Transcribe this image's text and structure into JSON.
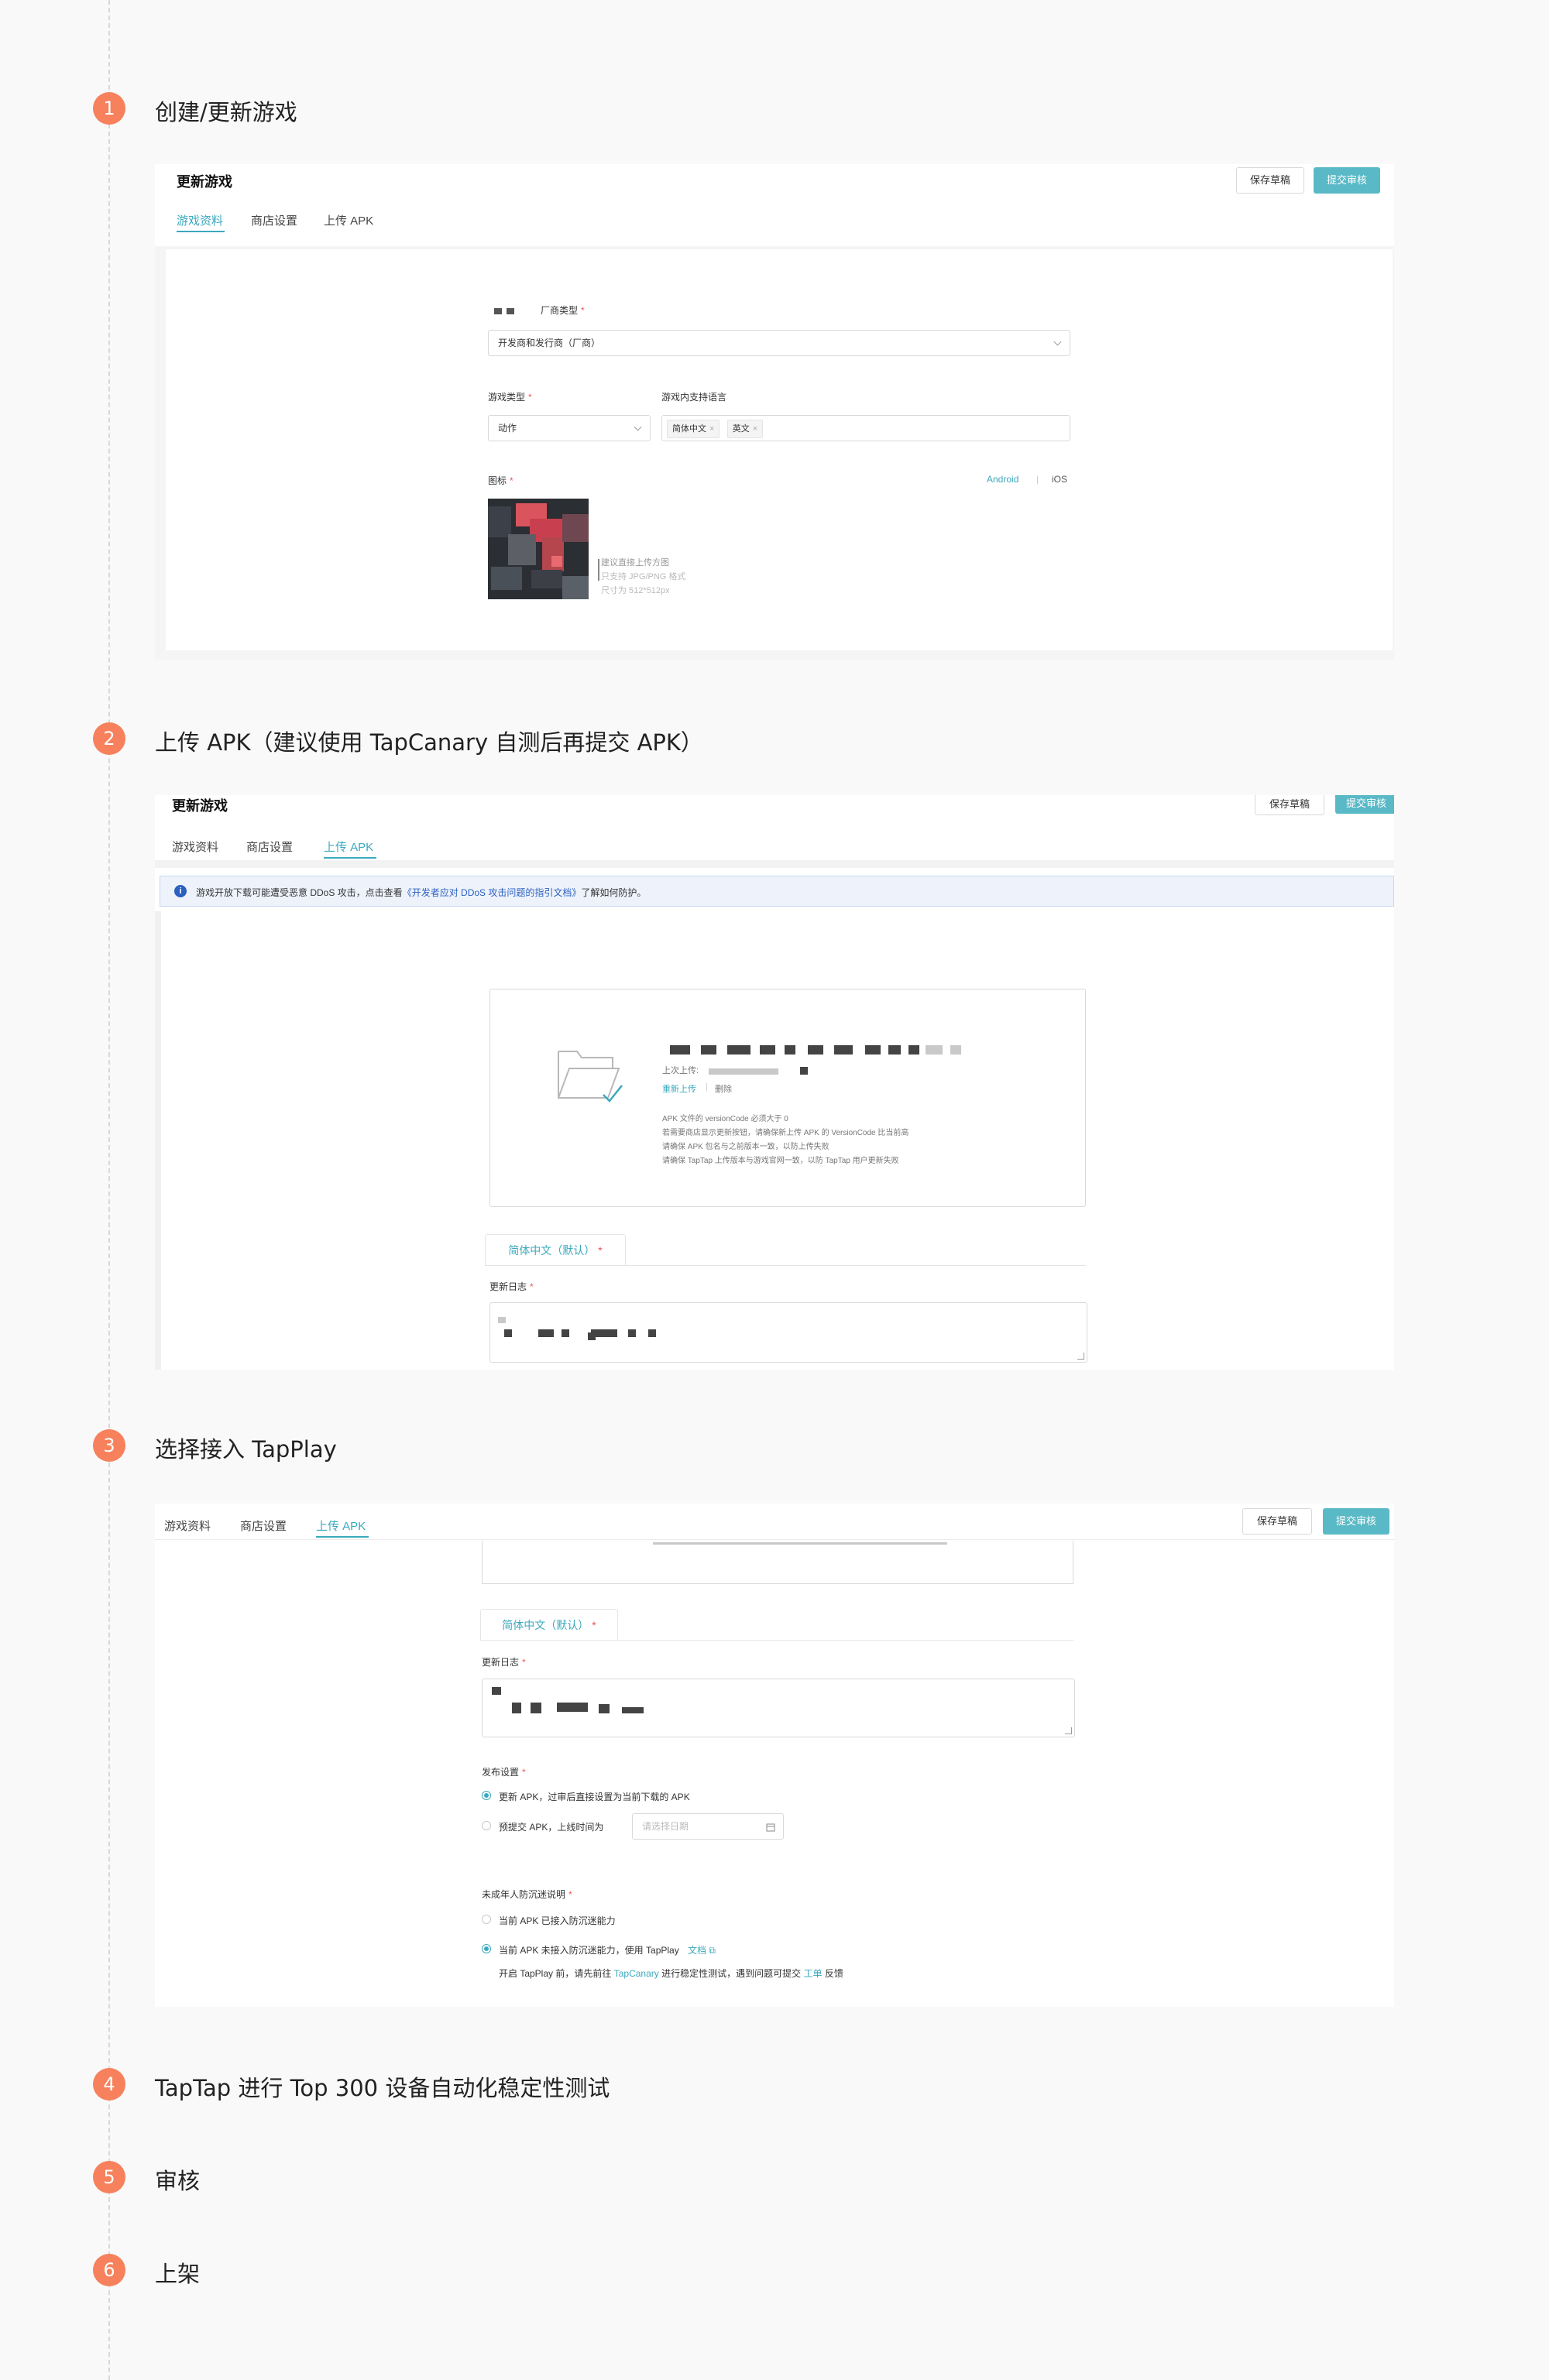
{
  "steps": [
    {
      "number": "1",
      "title": "创建/更新游戏"
    },
    {
      "number": "2",
      "title": "上传 APK（建议使用 TapCanary 自测后再提交 APK）"
    },
    {
      "number": "3",
      "title": "选择接入 TapPlay"
    },
    {
      "number": "4",
      "title": "TapTap 进行 Top 300 设备自动化稳定性测试"
    },
    {
      "number": "5",
      "title": "审核"
    },
    {
      "number": "6",
      "title": "上架"
    }
  ],
  "header": {
    "page_title": "更新游戏",
    "save_draft": "保存草稿",
    "submit_review": "提交审核"
  },
  "tabs": [
    "游戏资料",
    "商店设置",
    "上传 APK"
  ],
  "shot1": {
    "vendor_type_label": "厂商类型",
    "vendor_type_value": "开发商和发行商（厂商）",
    "game_type_label": "游戏类型",
    "game_type_value": "动作",
    "languages_label": "游戏内支持语言",
    "languages": [
      "简体中文",
      "英文"
    ],
    "icon_label": "图标",
    "platform_android": "Android",
    "platform_separator": "|",
    "platform_ios": "iOS",
    "icon_hints": [
      "建议直接上传方图",
      "只支持 JPG/PNG 格式",
      "尺寸为 512*512px"
    ]
  },
  "shot2": {
    "notice_icon": "info-icon",
    "notice_text": "游戏开放下载可能遭受恶意 DDoS 攻击，点击查看",
    "notice_link": "《开发者应对 DDoS 攻击问题的指引文档》",
    "notice_suffix": "了解如何防护。",
    "last_upload_label": "上次上传:",
    "reupload": "重新上传",
    "action_separator": "|",
    "delete": "删除",
    "apk_notes": [
      "APK 文件的 versionCode 必须大于 0",
      "若需要商店显示更新按钮，请确保新上传 APK 的 VersionCode 比当前高",
      "请确保 APK 包名与之前版本一致，以防上传失败",
      "请确保 TapTap 上传版本与游戏官网一致，以防 TapTap 用户更新失败"
    ],
    "lang_tab": "简体中文（默认）",
    "changelog_label": "更新日志"
  },
  "shot3": {
    "lang_tab": "简体中文（默认）",
    "changelog_label": "更新日志",
    "publish_label": "发布设置",
    "publish_option1": "更新 APK，过审后直接设置为当前下载的 APK",
    "publish_option2": "预提交 APK，上线时间为",
    "date_placeholder": "请选择日期",
    "minor_label": "未成年人防沉迷说明",
    "minor_option1": "当前 APK 已接入防沉迷能力",
    "minor_option2_prefix": "当前 APK 未接入防沉迷能力，使用 TapPlay",
    "minor_option2_link": "文档",
    "minor_hint_prefix": "开启 TapPlay 前，请先前往",
    "minor_hint_link1": "TapCanary",
    "minor_hint_mid": "进行稳定性测试，遇到问题可提交",
    "minor_hint_link2": "工单",
    "minor_hint_suffix": "反馈"
  },
  "colors": {
    "accent": "#3ba9bd",
    "primary_button": "#5ab9c6",
    "step_badge": "#f6815c",
    "required": "#ee5555"
  }
}
